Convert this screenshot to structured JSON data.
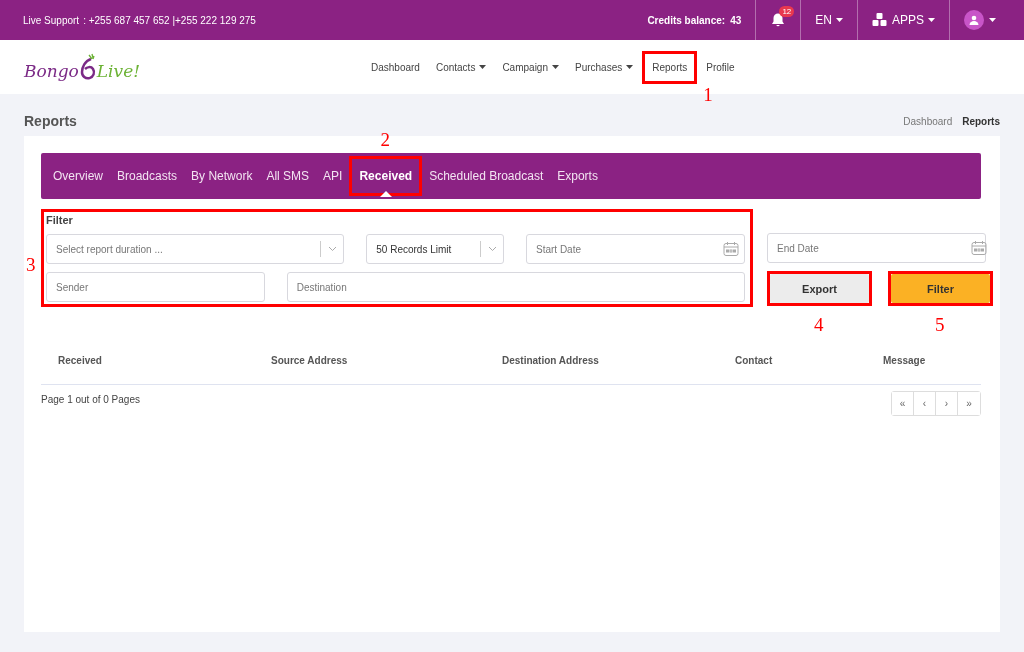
{
  "topbar": {
    "support_label": "Live Support",
    "support_numbers": ": +255 687 457 652 |+255 222 129 275",
    "credits_label": "Credits balance:",
    "credits_value": "43",
    "notifications_count": "12",
    "language": "EN",
    "apps_label": "APPS"
  },
  "logo": {
    "first": "Bongo",
    "second": "Live!"
  },
  "nav": [
    {
      "label": "Dashboard",
      "dropdown": false
    },
    {
      "label": "Contacts",
      "dropdown": true
    },
    {
      "label": "Campaign",
      "dropdown": true
    },
    {
      "label": "Purchases",
      "dropdown": true
    },
    {
      "label": "Reports",
      "dropdown": false,
      "annotation": "1"
    },
    {
      "label": "Profile",
      "dropdown": false
    }
  ],
  "page_title": "Reports",
  "breadcrumb": [
    {
      "label": "Dashboard",
      "current": false
    },
    {
      "label": "Reports",
      "current": true
    }
  ],
  "tabs": [
    {
      "label": "Overview",
      "selected": false
    },
    {
      "label": "Broadcasts",
      "selected": false
    },
    {
      "label": "By Network",
      "selected": false
    },
    {
      "label": "All SMS",
      "selected": false
    },
    {
      "label": "API",
      "selected": false
    },
    {
      "label": "Received",
      "selected": true,
      "annotation": "2"
    },
    {
      "label": "Scheduled Broadcast",
      "selected": false
    },
    {
      "label": "Exports",
      "selected": false
    }
  ],
  "filter": {
    "title": "Filter",
    "annotation": "3",
    "duration": {
      "placeholder": "Select report duration ..."
    },
    "limit": {
      "value": "50 Records Limit"
    },
    "start_date": {
      "placeholder": "Start Date"
    },
    "end_date": {
      "placeholder": "End Date"
    },
    "sender": {
      "placeholder": "Sender"
    },
    "destination": {
      "placeholder": "Destination"
    }
  },
  "buttons": [
    {
      "label": "Export",
      "kind": "secondary",
      "annotation": "4"
    },
    {
      "label": "Filter",
      "kind": "primary",
      "annotation": "5"
    }
  ],
  "table": {
    "columns": [
      "Received",
      "Source Address",
      "Destination Address",
      "Contact",
      "Message"
    ]
  },
  "pagination": {
    "summary": "Page 1 out of 0 Pages",
    "buttons": [
      "«",
      "‹",
      "›",
      "»"
    ]
  }
}
